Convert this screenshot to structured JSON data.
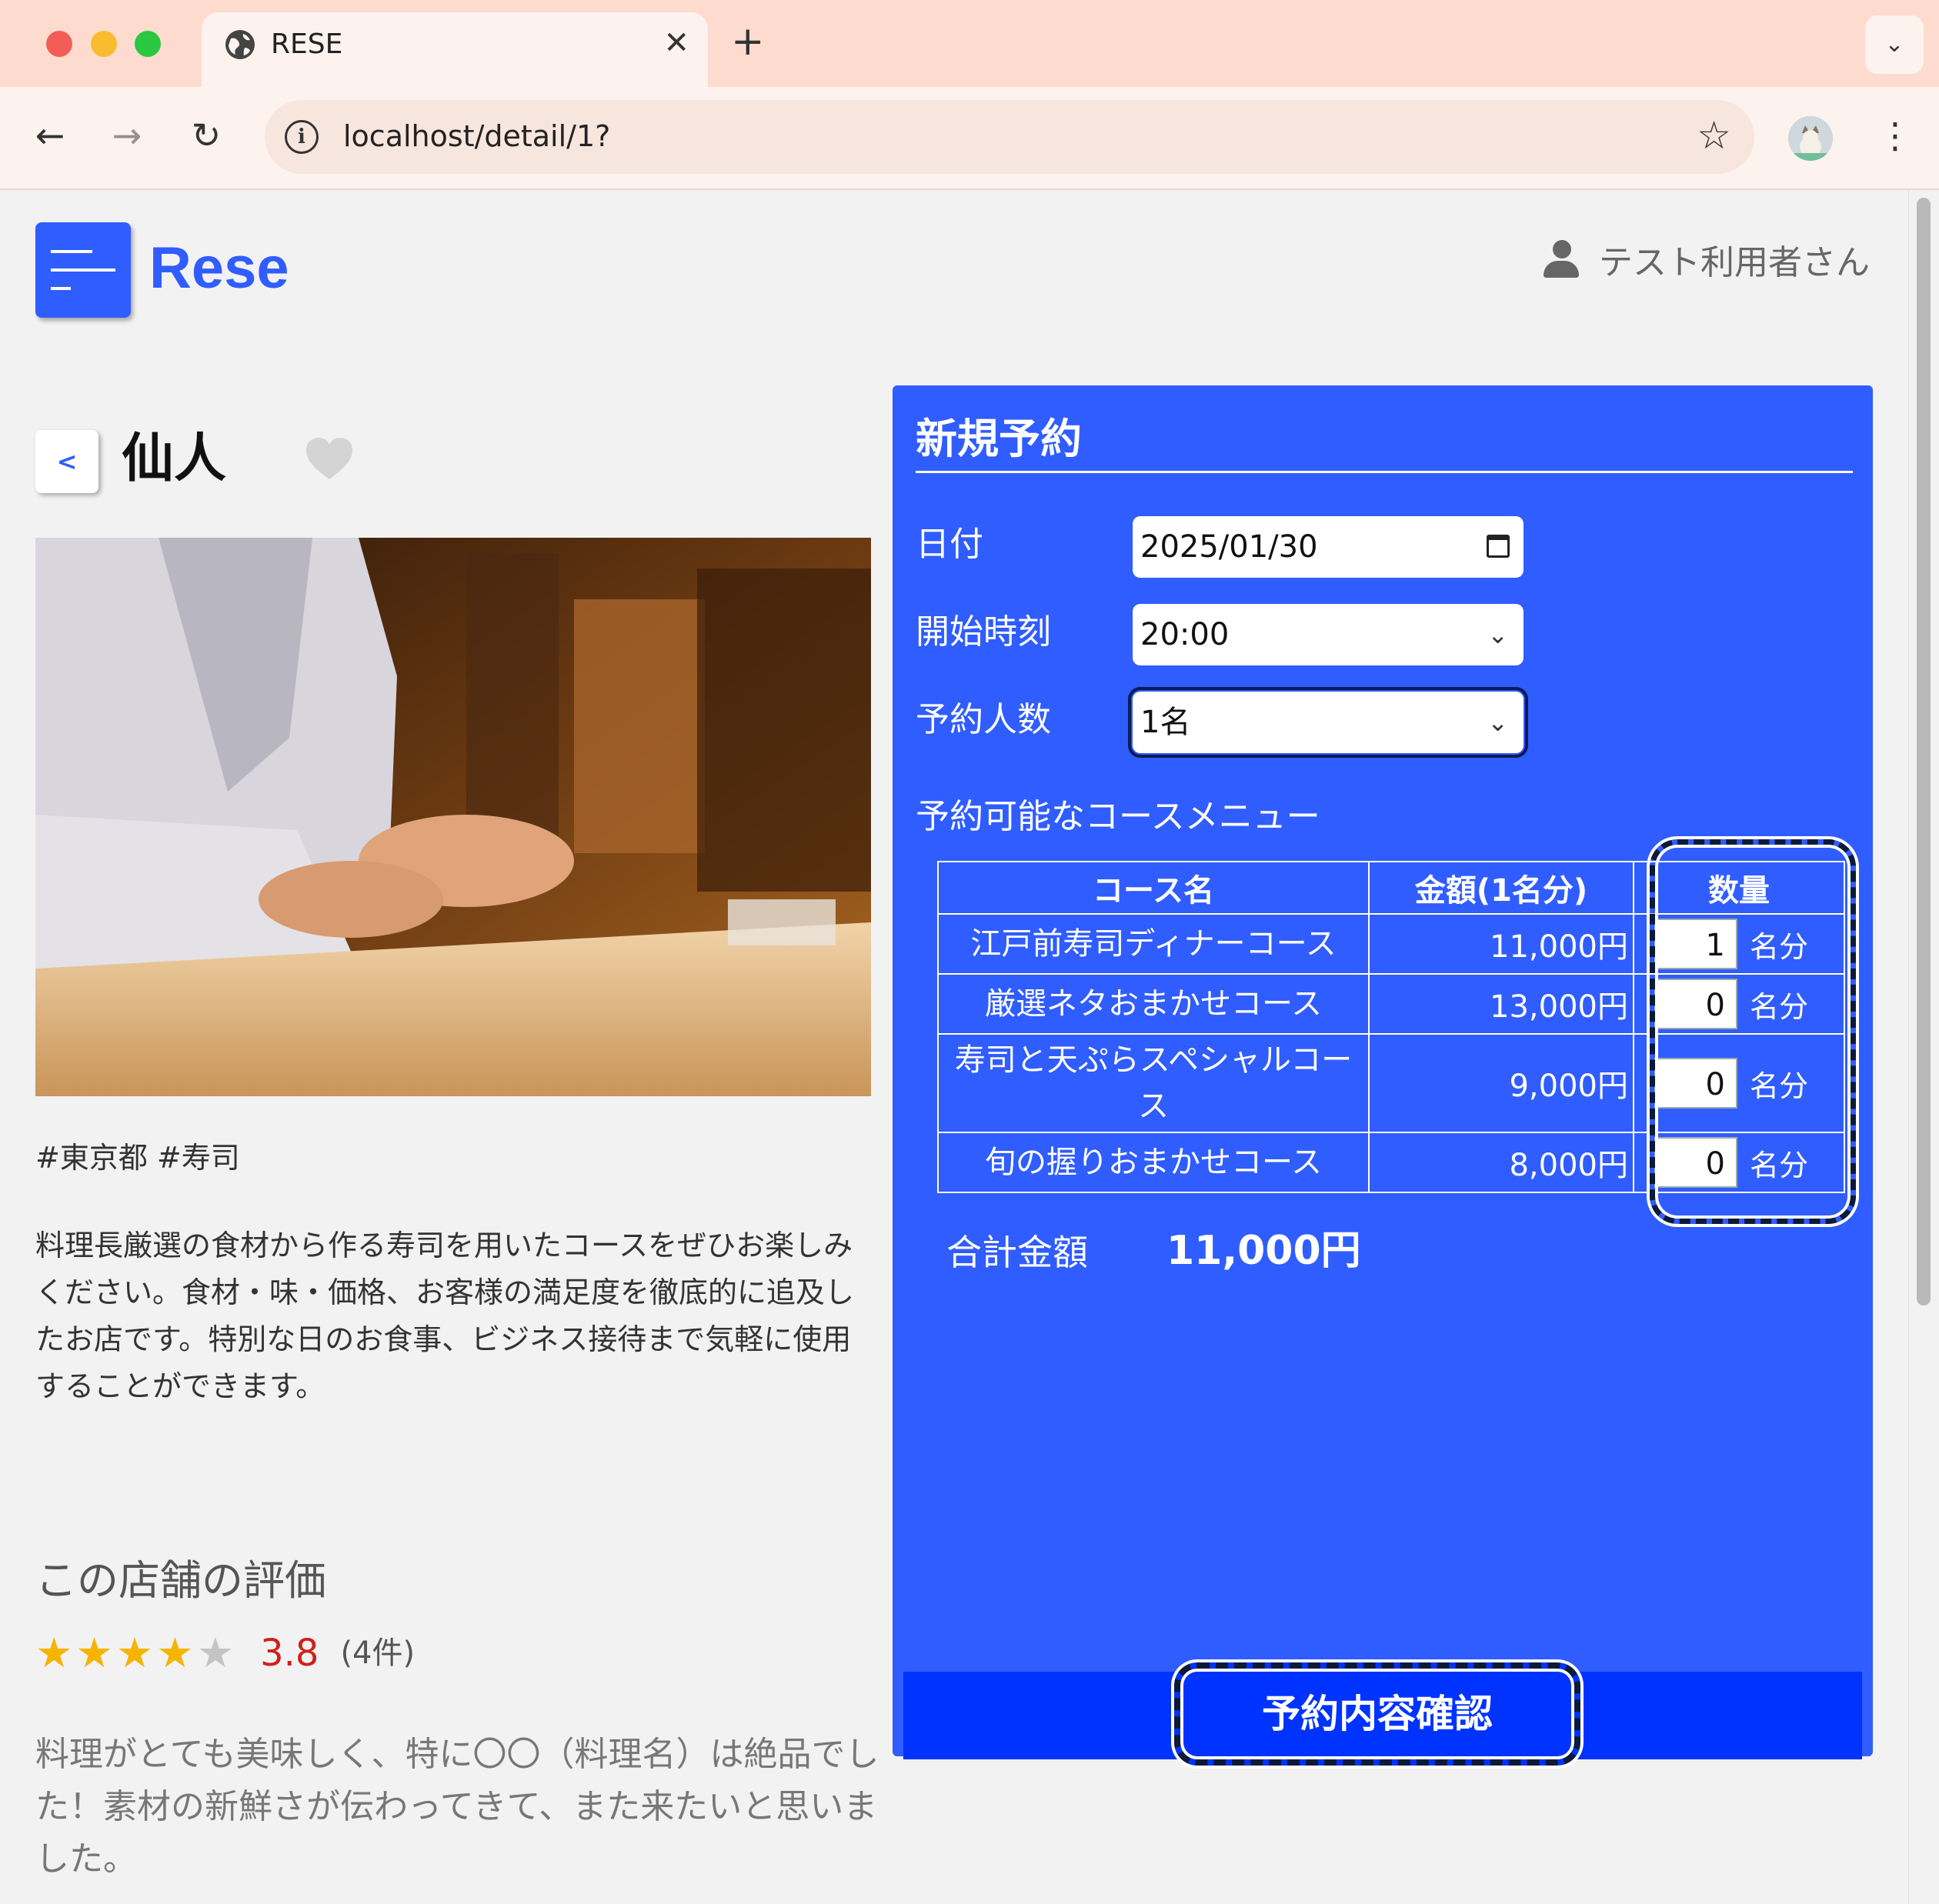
{
  "browser": {
    "tab_title": "RESE",
    "url": "localhost/detail/1?"
  },
  "header": {
    "logo": "Rese",
    "user_name": "テスト利用者さん"
  },
  "shop": {
    "back_label": "<",
    "name": "仙人",
    "tags": "#東京都 #寿司",
    "description": "料理長厳選の食材から作る寿司を用いたコースをぜひお楽しみください。食材・味・価格、お客様の満足度を徹底的に追及したお店です。特別な日のお食事、ビジネス接待まで気軽に使用することができます。"
  },
  "rating": {
    "heading": "この店舗の評価",
    "value": "3.8",
    "count": "(4件)",
    "stars": 3.8,
    "review": "料理がとても美味しく、特に〇〇（料理名）は絶品でした！素材の新鮮さが伝わってきて、また来たいと思いました。"
  },
  "reservation": {
    "title": "新規予約",
    "date_label": "日付",
    "date_value": "2025/01/30",
    "time_label": "開始時刻",
    "time_value": "20:00",
    "people_label": "予約人数",
    "people_value": "1名",
    "course_heading": "予約可能なコースメニュー",
    "table_headers": [
      "コース名",
      "金額(1名分)",
      "数量"
    ],
    "courses": [
      {
        "name": "江戸前寿司ディナーコース",
        "price": "11,000円",
        "qty": "1",
        "unit": "名分"
      },
      {
        "name": "厳選ネタおまかせコース",
        "price": "13,000円",
        "qty": "0",
        "unit": "名分"
      },
      {
        "name": "寿司と天ぷらスペシャルコース",
        "price": "9,000円",
        "qty": "0",
        "unit": "名分"
      },
      {
        "name": "旬の握りおまかせコース",
        "price": "8,000円",
        "qty": "0",
        "unit": "名分"
      }
    ],
    "total_label": "合計金額",
    "total_value": "11,000円",
    "confirm_label": "予約内容確認"
  },
  "colors": {
    "brand": "#305dff",
    "confirm": "#0033ff",
    "rating": "#d0201b",
    "star": "#f5b400"
  },
  "icons": [
    "globe-icon",
    "close-icon",
    "plus-icon",
    "chevron-down-icon",
    "back-arrow-icon",
    "forward-arrow-icon",
    "reload-icon",
    "info-icon",
    "bookmark-star-icon",
    "profile-avatar",
    "kebab-menu-icon",
    "hamburger-icon",
    "user-icon",
    "heart-icon",
    "calendar-icon",
    "star-icon"
  ]
}
